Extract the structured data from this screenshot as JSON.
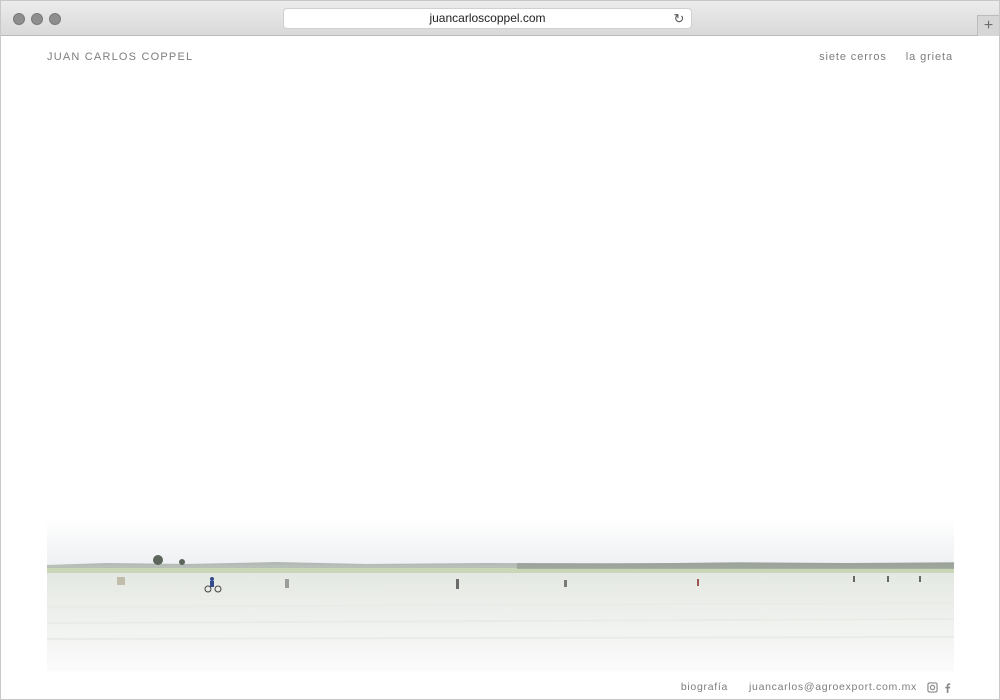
{
  "browser": {
    "url": "juancarloscoppel.com",
    "reload_icon": "reload-icon",
    "new_tab_icon": "plus-icon"
  },
  "site": {
    "title": "JUAN CARLOS COPPEL",
    "nav": [
      "siete cerros",
      "la grieta"
    ]
  },
  "hero": {
    "description_icon": "landscape-photo"
  },
  "footer": {
    "biography": "biografía",
    "email": "juancarlos@agroexport.com.mx",
    "icons": [
      "instagram-icon",
      "facebook-icon"
    ]
  }
}
